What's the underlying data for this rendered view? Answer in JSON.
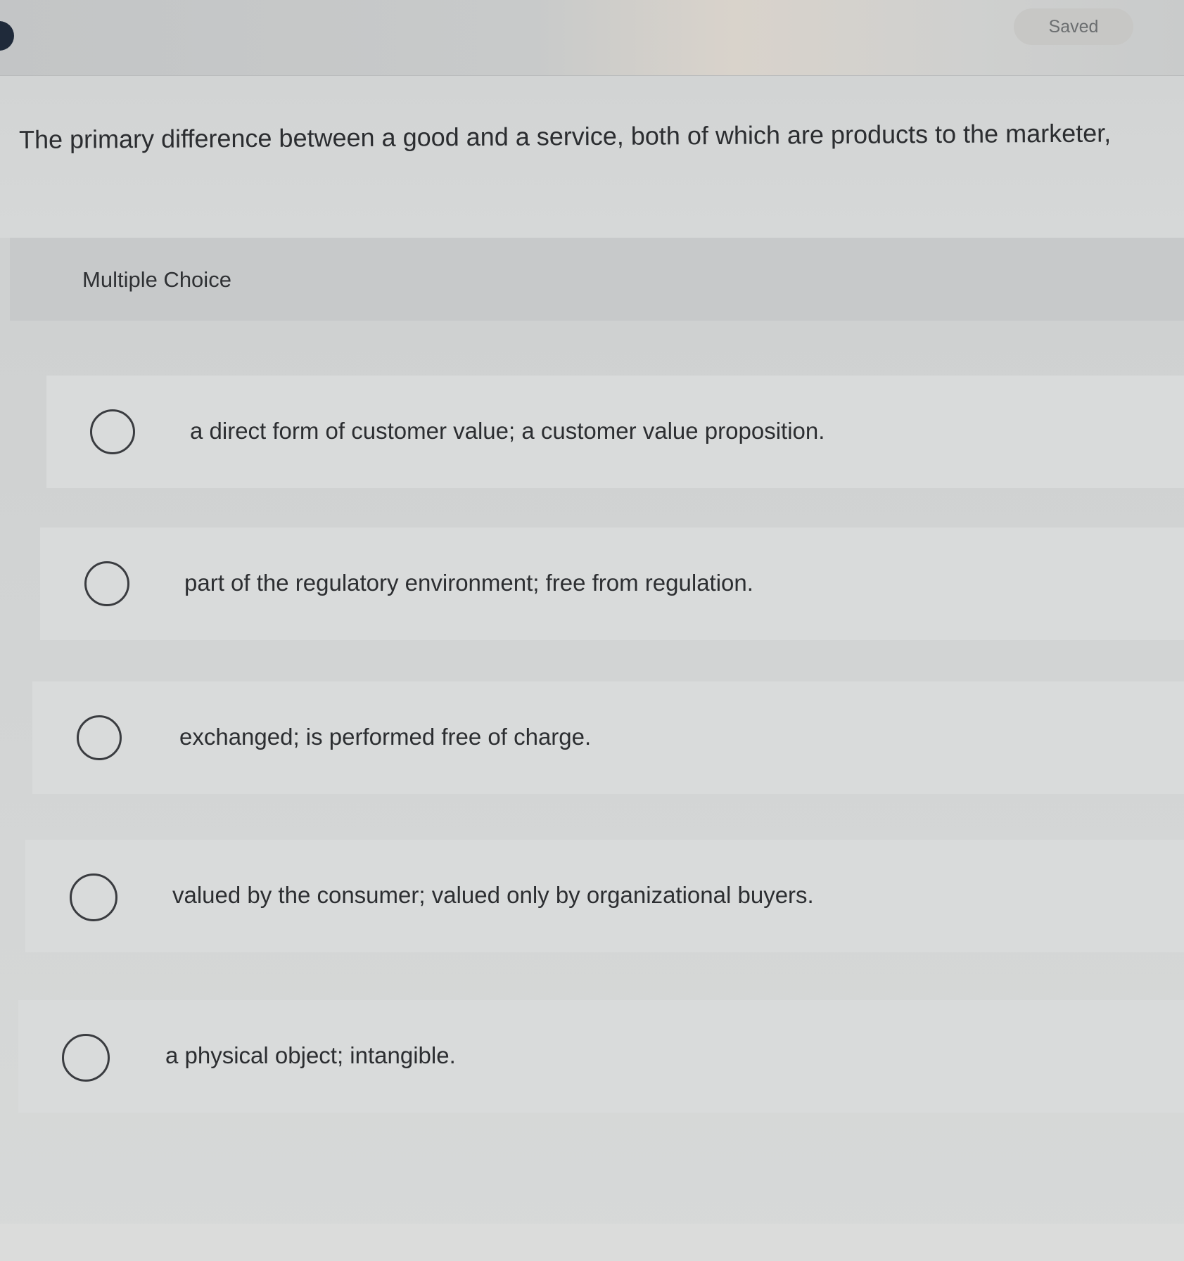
{
  "header": {
    "saved_label": "Saved"
  },
  "question": {
    "text": "The primary difference between a good and a service, both of which are products to the marketer,"
  },
  "section": {
    "label": "Multiple Choice"
  },
  "options": [
    {
      "label": "a direct form of customer value; a customer value proposition."
    },
    {
      "label": "part of the regulatory environment; free from regulation."
    },
    {
      "label": "exchanged; is performed free of charge."
    },
    {
      "label": "valued by the consumer; valued only by organizational buyers."
    },
    {
      "label": "a physical object; intangible."
    }
  ]
}
